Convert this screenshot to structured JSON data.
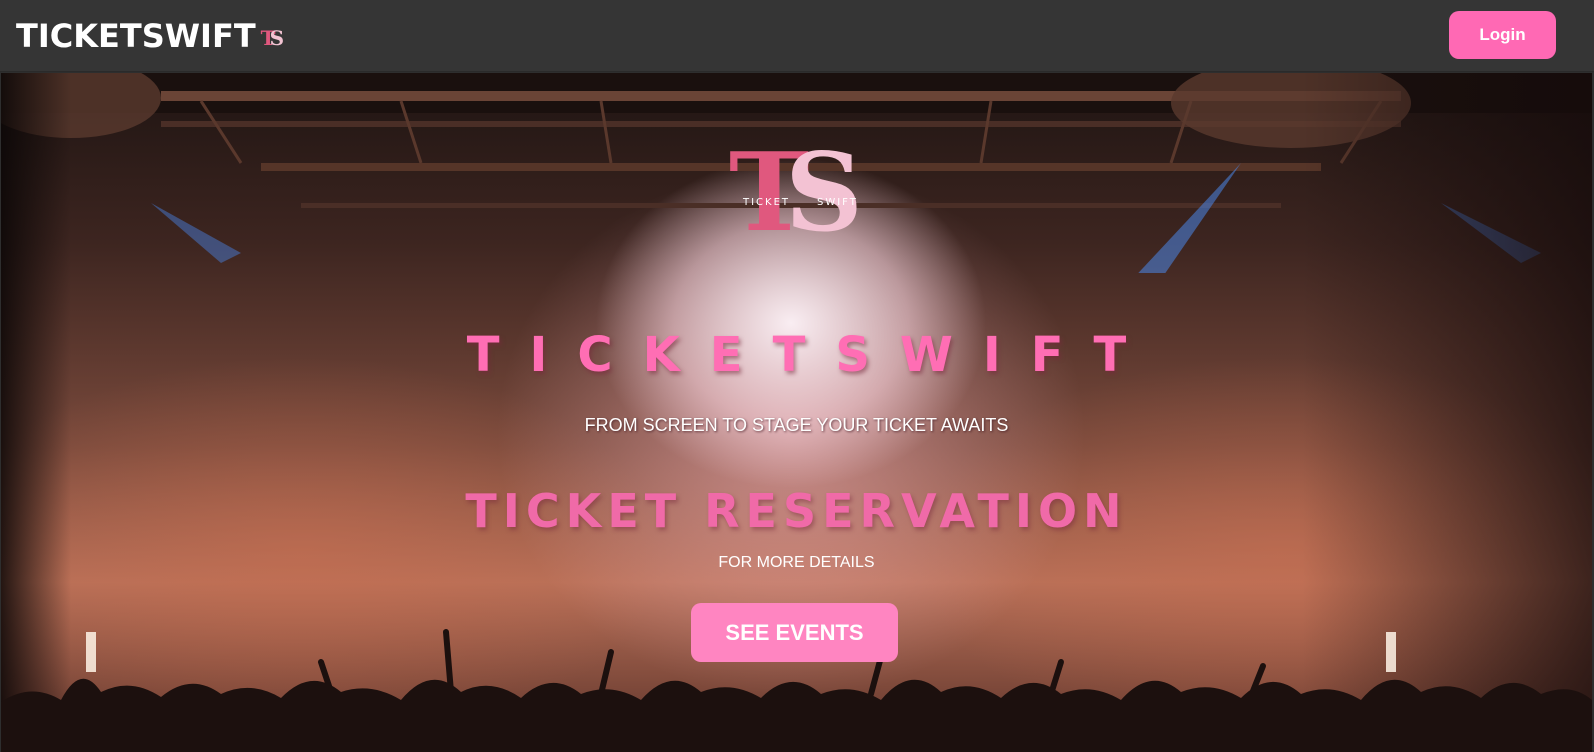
{
  "navbar": {
    "brand": "TICKETSWIFT",
    "brand_mark": {
      "t": "T",
      "s": "S"
    },
    "login_label": "Login"
  },
  "hero": {
    "logo": {
      "t": "T",
      "s": "S",
      "left_text": "TICKET",
      "right_text": "SWIFT"
    },
    "title": "TICKETSWIFT",
    "tagline": "FROM SCREEN TO STAGE YOUR TICKET AWAITS",
    "subtitle": "TICKET RESERVATION",
    "note": "FOR MORE DETAILS",
    "cta_label": "SEE EVENTS"
  },
  "colors": {
    "accent": "#ff69b4",
    "navbar_bg": "#353535",
    "logo_t": "#e0587e",
    "logo_s": "#f3c2d3"
  }
}
